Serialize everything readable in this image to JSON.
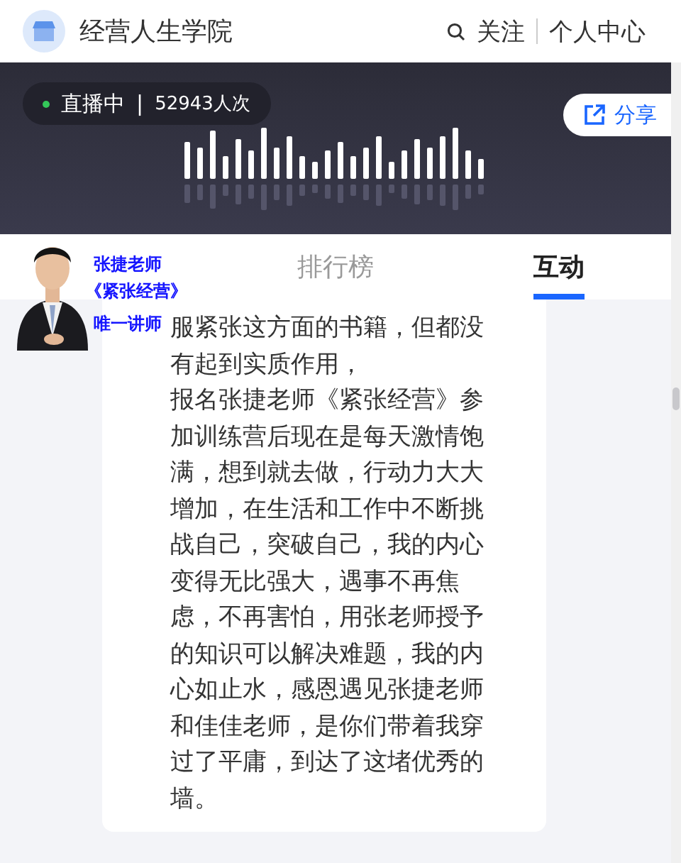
{
  "header": {
    "title": "经营人生学院",
    "follow": "关注",
    "profile": "个人中心"
  },
  "live": {
    "status": "直播中",
    "separator": "|",
    "views": "52943人次",
    "share": "分享"
  },
  "tabs": [
    {
      "label": "排行榜",
      "selected": false
    },
    {
      "label": "互动",
      "selected": true
    }
  ],
  "promo": {
    "lines": [
      "张捷老师",
      "《紧张经营》",
      "唯一讲师"
    ]
  },
  "message": {
    "paragraphs": [
      "服紧张这方面的书籍，但都没有起到实质作用，",
      "报名张捷老师《紧张经营》参加训练营后现在是每天激情饱满，想到就去做，行动力大大增加，在生活和工作中不断挑战自己，突破自己，我的内心变得无比强大，遇事不再焦虑，不再害怕，用张老师授予的知识可以解决难题，我的内心如止水，感恩遇见张捷老师和佳佳老师，是你们带着我穿过了平庸，到达了这堵优秀的墙。"
    ]
  }
}
